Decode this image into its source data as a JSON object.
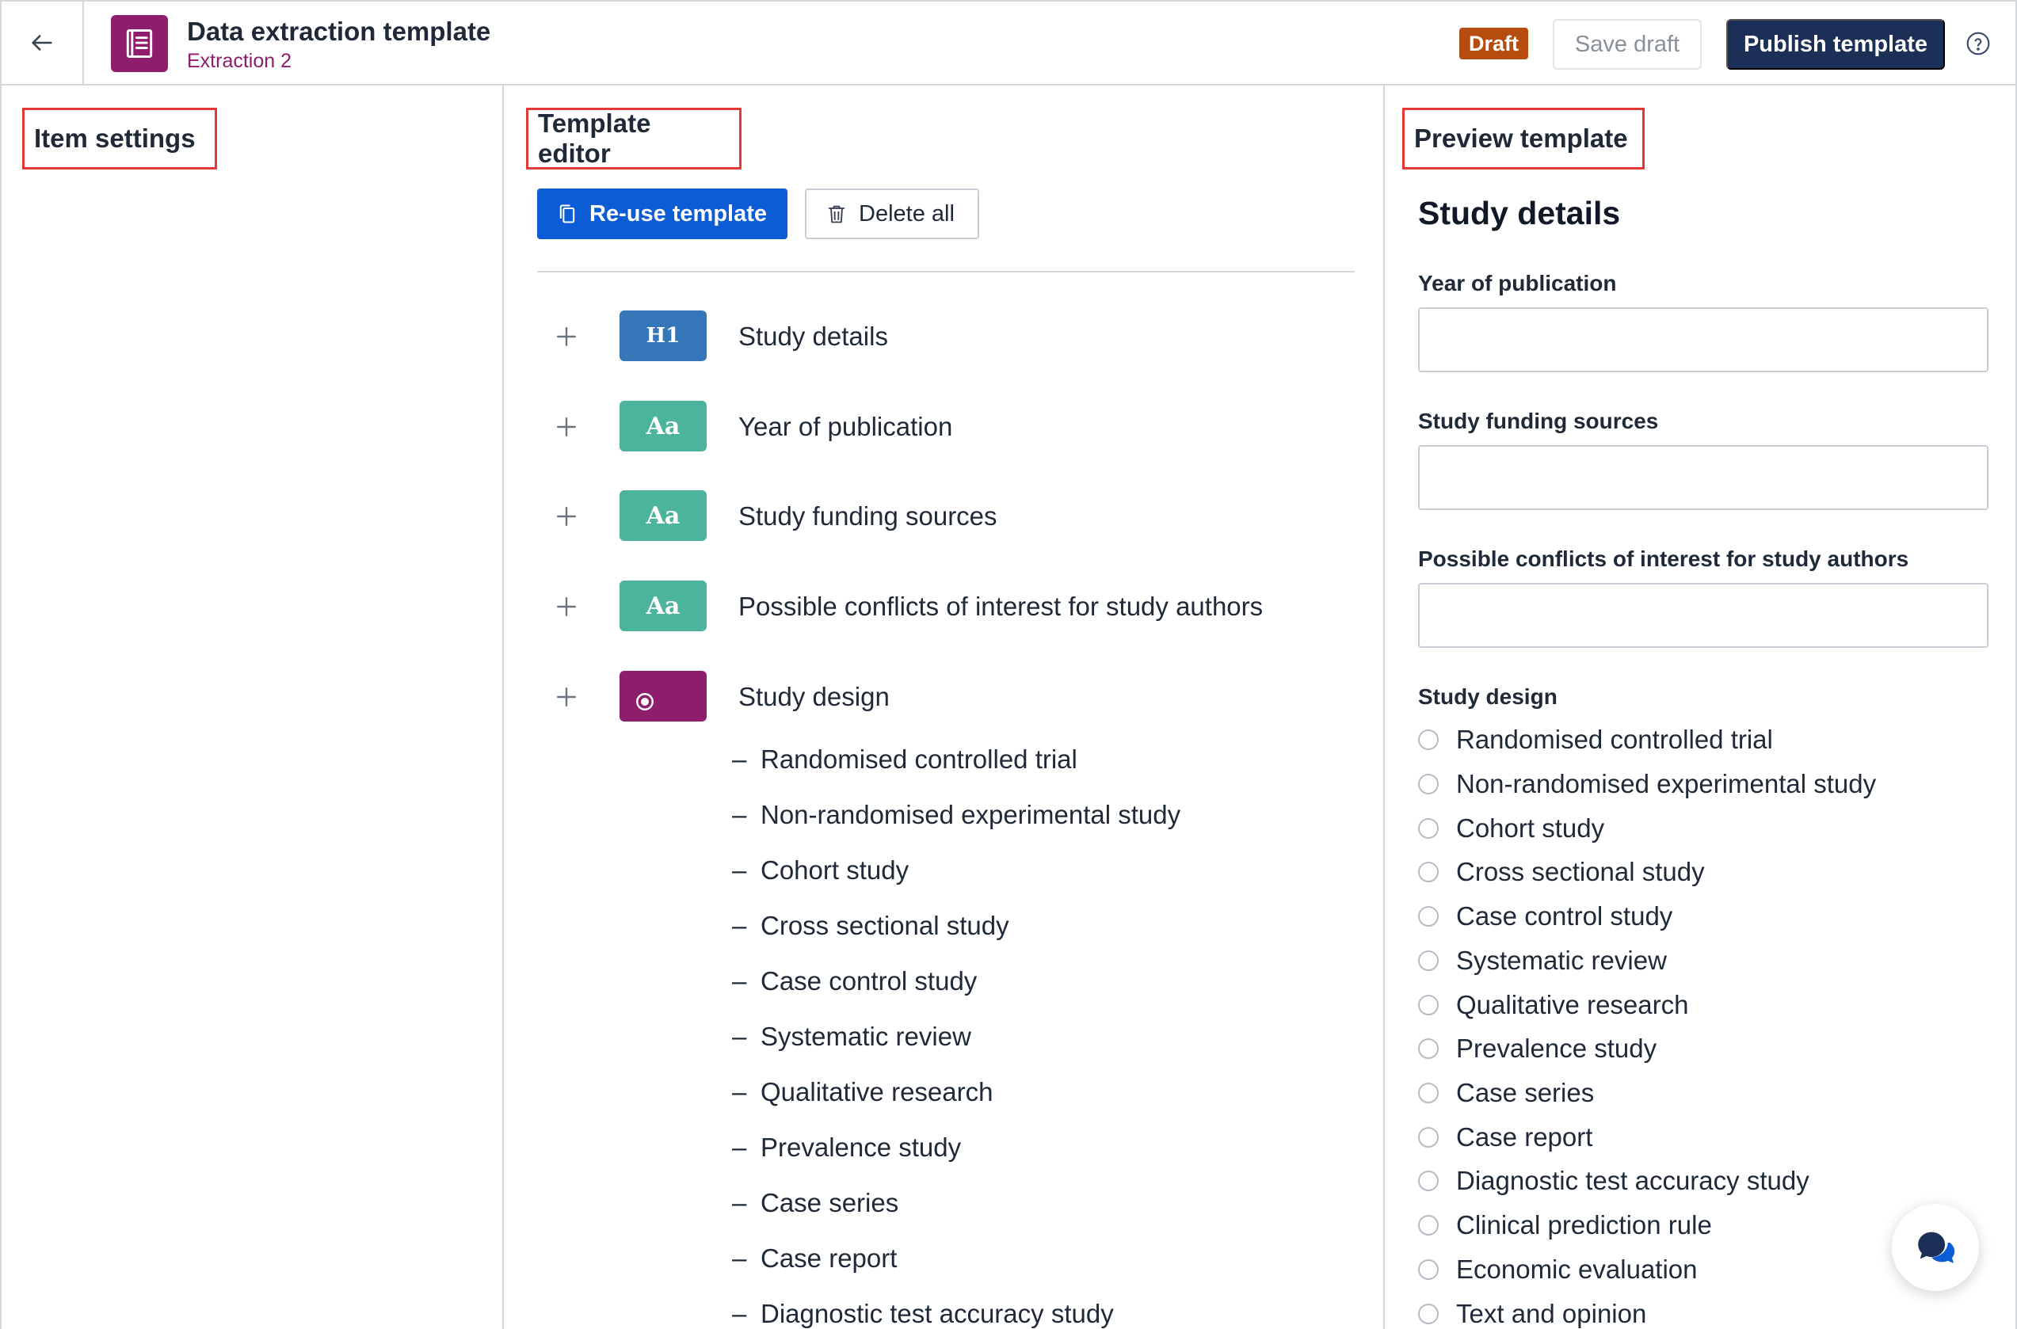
{
  "header": {
    "back_icon": "arrow-left-icon",
    "logo_icon": "book-icon",
    "title": "Data extraction template",
    "subtitle": "Extraction 2",
    "status_badge": "Draft",
    "save_draft_label": "Save draft",
    "publish_label": "Publish template",
    "help_icon": "help-circle-icon",
    "colors": {
      "logo": "#8e1d6c",
      "badge": "#b64d0e",
      "publish": "#1b2f57"
    }
  },
  "item_settings": {
    "heading": "Item settings"
  },
  "editor": {
    "heading": "Template editor",
    "reuse_label": "Re-use template",
    "delete_all_label": "Delete all",
    "items": [
      {
        "badge": "H1",
        "type": "heading",
        "label": "Study details"
      },
      {
        "badge": "Aa",
        "type": "text",
        "label": "Year of publication"
      },
      {
        "badge": "Aa",
        "type": "text",
        "label": "Study funding sources"
      },
      {
        "badge": "Aa",
        "type": "text",
        "label": "Possible conflicts of interest for study authors"
      },
      {
        "badge": "radio",
        "type": "single-choice",
        "label": "Study design"
      }
    ],
    "options": [
      "Randomised controlled trial",
      "Non-randomised experimental study",
      "Cohort study",
      "Cross sectional study",
      "Case control study",
      "Systematic review",
      "Qualitative research",
      "Prevalence study",
      "Case series",
      "Case report",
      "Diagnostic test accuracy study"
    ]
  },
  "preview": {
    "heading": "Preview template",
    "section_title": "Study details",
    "fields": [
      {
        "label": "Year of publication",
        "value": ""
      },
      {
        "label": "Study funding sources",
        "value": ""
      },
      {
        "label": "Possible conflicts of interest for study authors",
        "value": ""
      }
    ],
    "radio_group_label": "Study design",
    "radio_options": [
      "Randomised controlled trial",
      "Non-randomised experimental study",
      "Cohort study",
      "Cross sectional study",
      "Case control study",
      "Systematic review",
      "Qualitative research",
      "Prevalence study",
      "Case series",
      "Case report",
      "Diagnostic test accuracy study",
      "Clinical prediction rule",
      "Economic evaluation",
      "Text and opinion"
    ]
  },
  "chat_icon": "chat-bubbles-icon"
}
